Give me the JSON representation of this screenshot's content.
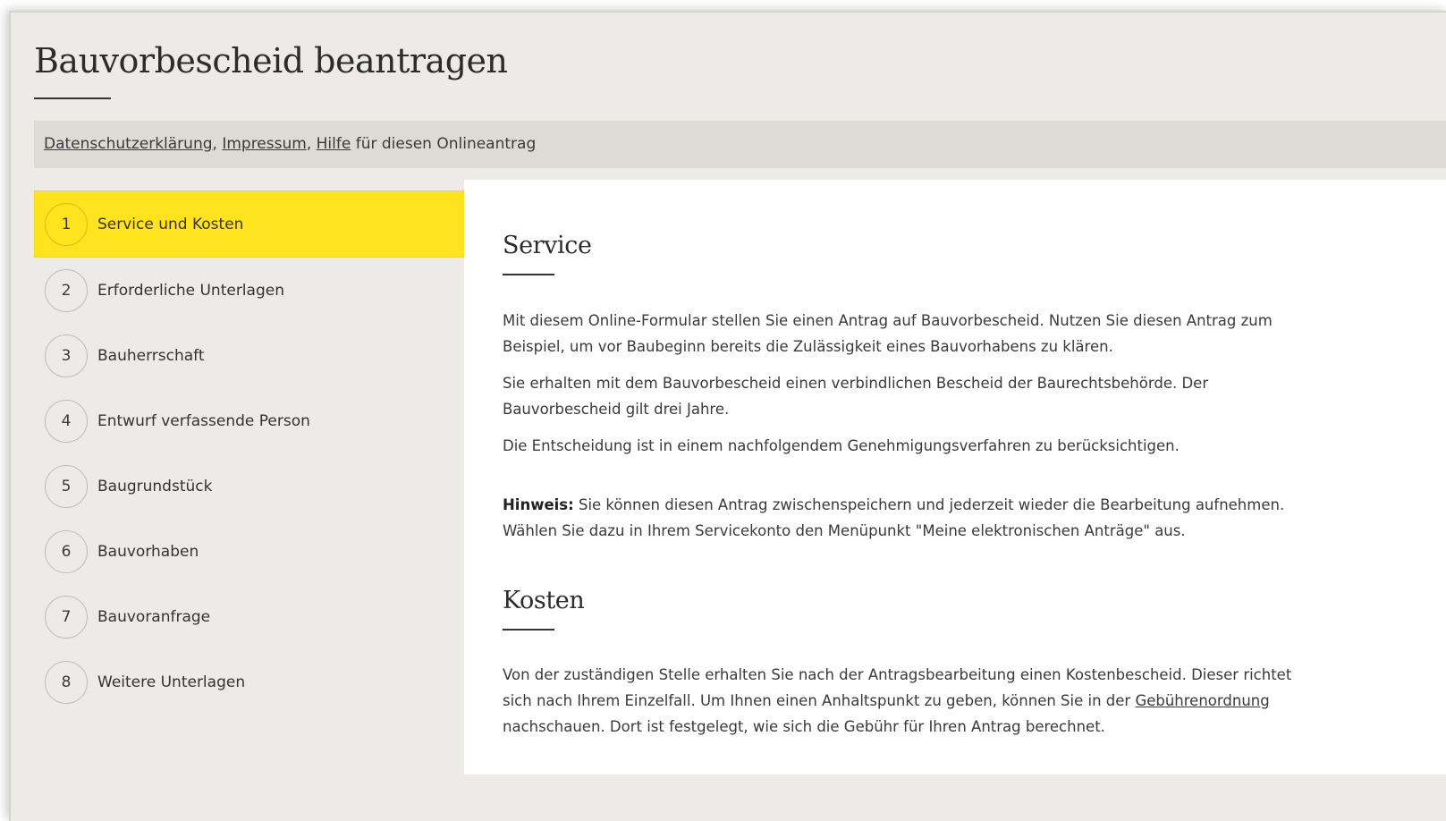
{
  "page": {
    "title": "Bauvorbescheid beantragen"
  },
  "info_bar": {
    "links": [
      "Datenschutzerklärung",
      "Impressum",
      "Hilfe"
    ],
    "separator": ", ",
    "suffix": " für diesen Onlineantrag"
  },
  "steps": [
    {
      "number": "1",
      "label": "Service und Kosten",
      "active": true
    },
    {
      "number": "2",
      "label": "Erforderliche Unterlagen",
      "active": false
    },
    {
      "number": "3",
      "label": "Bauherrschaft",
      "active": false
    },
    {
      "number": "4",
      "label": "Entwurf verfassende Person",
      "active": false
    },
    {
      "number": "5",
      "label": "Baugrundstück",
      "active": false
    },
    {
      "number": "6",
      "label": "Bauvorhaben",
      "active": false
    },
    {
      "number": "7",
      "label": "Bauvoranfrage",
      "active": false
    },
    {
      "number": "8",
      "label": "Weitere Unterlagen",
      "active": false
    }
  ],
  "service": {
    "heading": "Service",
    "p1": "Mit diesem Online-Formular stellen Sie einen Antrag auf Bauvorbescheid. Nutzen Sie diesen Antrag zum Beispiel, um vor Baubeginn bereits die Zulässigkeit eines Bauvorhabens zu klären.",
    "p2": "Sie erhalten mit dem Bauvorbescheid einen verbindlichen Bescheid der Baurechtsbehörde. Der Bauvorbescheid gilt drei Jahre.",
    "p3": "Die Entscheidung ist in einem nachfolgendem Genehmigungsverfahren zu berücksichtigen.",
    "hint_label": "Hinweis:",
    "hint_text": " Sie können diesen Antrag zwischenspeichern und jederzeit wieder die Bearbeitung aufnehmen. Wählen Sie dazu in Ihrem Servicekonto den Menüpunkt \"Meine elektronischen Anträge\" aus."
  },
  "kosten": {
    "heading": "Kosten",
    "text_before": "Von der zuständigen Stelle erhalten Sie nach der Antragsbearbeitung einen Kostenbescheid. Dieser richtet sich nach Ihrem Einzelfall. Um Ihnen einen Anhaltspunkt zu geben, können Sie in der ",
    "link": "Gebührenordnung",
    "text_after": " nachschauen. Dort ist festgelegt, wie sich die Gebühr für Ihren Antrag berechnet."
  },
  "colors": {
    "active_step": "#ffe31e",
    "background": "#ecebe7",
    "info_bar": "#dcdbd6",
    "content": "#ffffff"
  }
}
